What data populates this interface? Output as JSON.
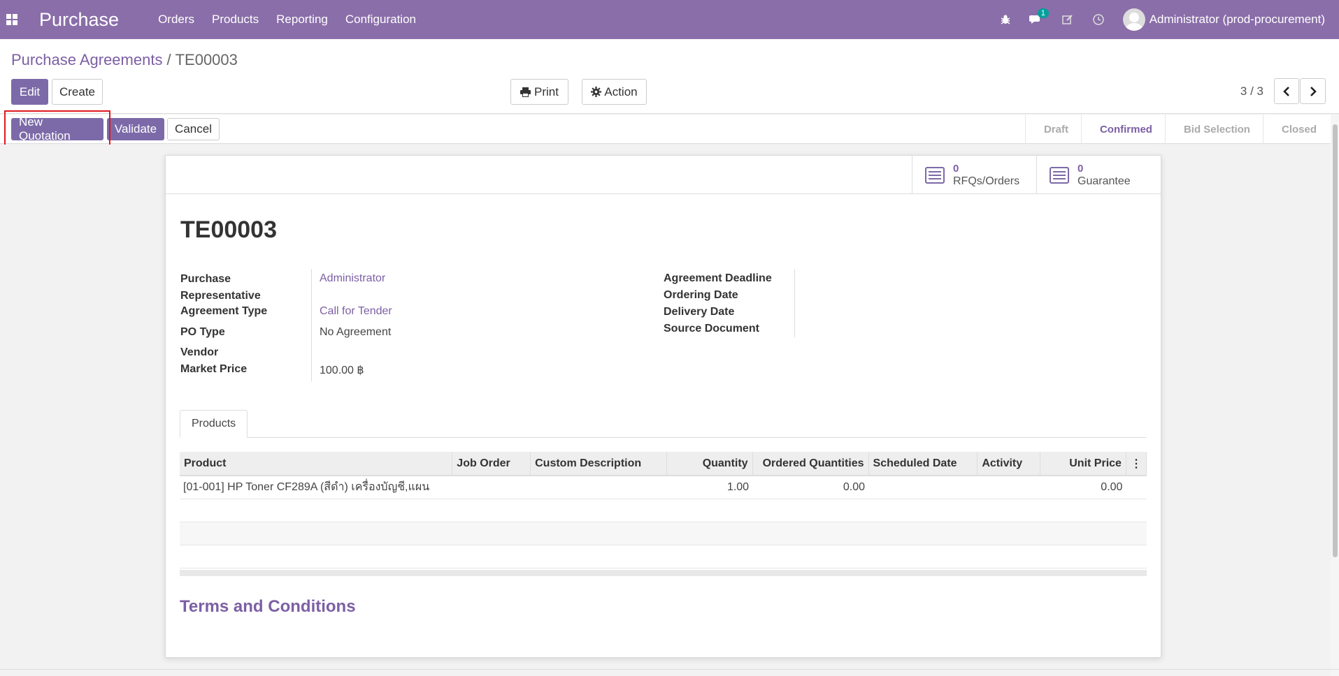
{
  "navbar": {
    "app_title": "Purchase",
    "menu": [
      "Orders",
      "Products",
      "Reporting",
      "Configuration"
    ],
    "chat_badge": "1",
    "user": "Administrator (prod-procurement)"
  },
  "breadcrumb": {
    "parent": "Purchase Agreements",
    "separator": "/",
    "current": "TE00003"
  },
  "toolbar": {
    "edit": "Edit",
    "create": "Create",
    "print": "Print",
    "action": "Action"
  },
  "pager": {
    "label": "3 / 3"
  },
  "statusbar": {
    "buttons": {
      "new_quotation": "New Quotation",
      "validate": "Validate",
      "cancel": "Cancel"
    },
    "stages": [
      "Draft",
      "Confirmed",
      "Bid Selection",
      "Closed"
    ],
    "active_stage": "Confirmed"
  },
  "smart_buttons": [
    {
      "count": "0",
      "label": "RFQs/Orders"
    },
    {
      "count": "0",
      "label": "Guarantee"
    }
  ],
  "record": {
    "name": "TE00003",
    "left_fields": [
      {
        "label": "Purchase Representative",
        "value": "Administrator"
      },
      {
        "label": "Agreement Type",
        "value": "Call for Tender"
      },
      {
        "label": "PO Type",
        "value": "No Agreement"
      },
      {
        "label": "Vendor",
        "value": ""
      },
      {
        "label": "Market Price",
        "value": "100.00 ฿"
      }
    ],
    "right_fields": [
      {
        "label": "Agreement Deadline",
        "value": ""
      },
      {
        "label": "Ordering Date",
        "value": ""
      },
      {
        "label": "Delivery Date",
        "value": ""
      },
      {
        "label": "Source Document",
        "value": ""
      }
    ]
  },
  "tabs": [
    "Products"
  ],
  "lines_table": {
    "columns": [
      "Product",
      "Job Order",
      "Custom Description",
      "Quantity",
      "Ordered Quantities",
      "Scheduled Date",
      "Activity",
      "Unit Price"
    ],
    "rows": [
      [
        "[01-001] HP Toner CF289A (สีดำ) เครื่องบัญชี,แผน",
        "",
        "",
        "1.00",
        "0.00",
        "",
        "",
        "0.00"
      ]
    ]
  },
  "terms_heading": "Terms and Conditions",
  "colors": {
    "brand": "#8a6ea9",
    "accent": "#7c5fa4",
    "highlight": "#e0191f"
  }
}
